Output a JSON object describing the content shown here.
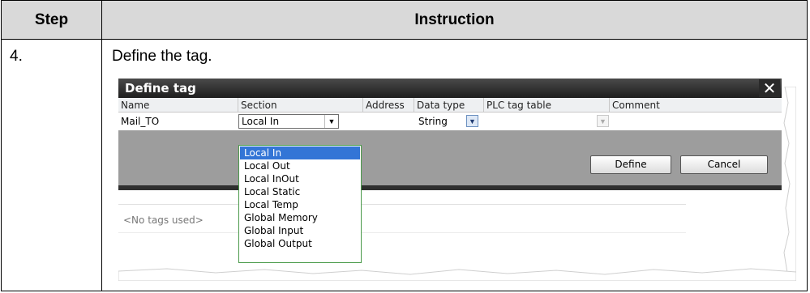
{
  "table": {
    "header_step": "Step",
    "header_instruction": "Instruction",
    "step_number": "4.",
    "instruction_text": "Define the tag."
  },
  "dialog": {
    "title": "Define tag",
    "close_symbol": "✕",
    "columns": [
      "Name",
      "Section",
      "Address",
      "Data type",
      "PLC tag table",
      "Comment"
    ],
    "row": {
      "name": "Mail_TO",
      "section": "Local In",
      "address": "",
      "data_type": "String",
      "plc_tag_table": "",
      "comment": ""
    },
    "section_options": [
      "Local In",
      "Local Out",
      "Local InOut",
      "Local Static",
      "Local Temp",
      "Global Memory",
      "Global Input",
      "Global Output"
    ],
    "selected_option": "Local In",
    "define_button": "Define",
    "cancel_button": "Cancel",
    "no_tags_text": "<No tags used>"
  }
}
